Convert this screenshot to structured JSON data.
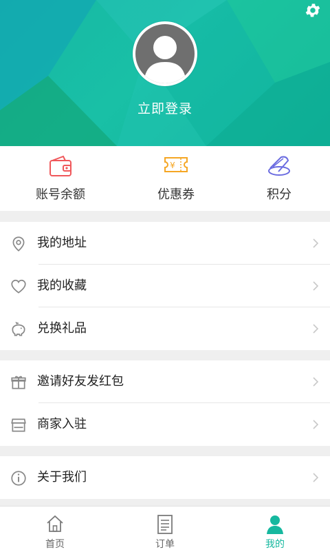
{
  "header": {
    "login_text": "立即登录",
    "settings_icon": "gear-icon",
    "avatar_icon": "user-avatar-placeholder"
  },
  "quick_actions": [
    {
      "label": "账号余额",
      "icon": "wallet-icon",
      "color": "#f0575a"
    },
    {
      "label": "优惠券",
      "icon": "coupon-icon",
      "color": "#f5a623"
    },
    {
      "label": "积分",
      "icon": "coins-icon",
      "color": "#6a6be0"
    }
  ],
  "menu_group_1": [
    {
      "label": "我的地址",
      "icon": "location-pin-icon"
    },
    {
      "label": "我的收藏",
      "icon": "heart-icon"
    },
    {
      "label": "兑换礼品",
      "icon": "piggy-bank-icon"
    }
  ],
  "menu_group_2": [
    {
      "label": "邀请好友发红包",
      "icon": "gift-icon"
    },
    {
      "label": "商家入驻",
      "icon": "store-icon"
    }
  ],
  "menu_group_3": [
    {
      "label": "关于我们",
      "icon": "info-icon"
    }
  ],
  "bottom_nav": [
    {
      "label": "首页",
      "icon": "home-icon",
      "active": false
    },
    {
      "label": "订单",
      "icon": "order-list-icon",
      "active": false
    },
    {
      "label": "我的",
      "icon": "person-icon",
      "active": true
    }
  ],
  "colors": {
    "brand": "#16b89f",
    "header_bg": "#17b7a4"
  }
}
